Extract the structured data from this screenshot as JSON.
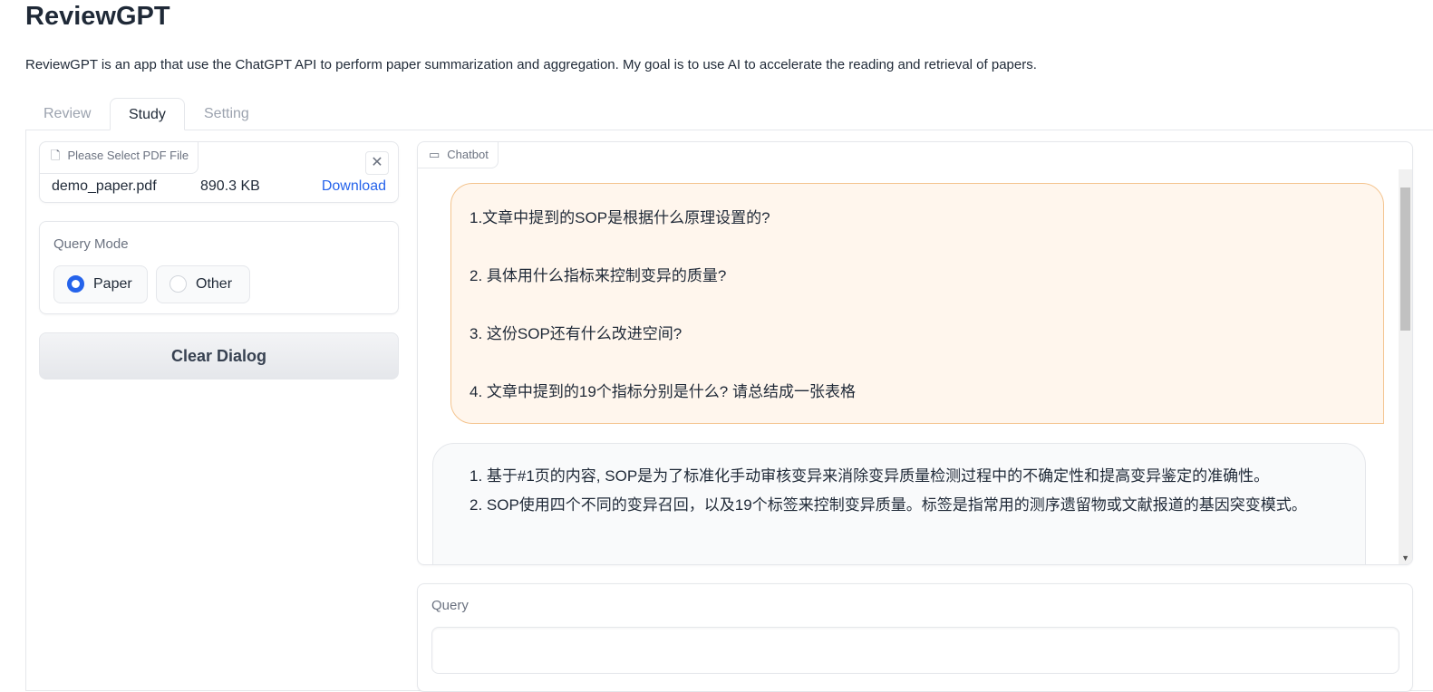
{
  "app": {
    "title": "ReviewGPT",
    "description": "ReviewGPT is an app that use the ChatGPT API to perform paper summarization and aggregation. My goal is to use AI to accelerate the reading and retrieval of papers."
  },
  "tabs": [
    {
      "label": "Review"
    },
    {
      "label": "Study",
      "active": true
    },
    {
      "label": "Setting"
    }
  ],
  "file": {
    "label": "Please Select PDF File",
    "name": "demo_paper.pdf",
    "size": "890.3 KB",
    "download": "Download"
  },
  "query_mode": {
    "label": "Query Mode",
    "options": [
      "Paper",
      "Other"
    ],
    "selected": "Paper"
  },
  "clear_button": "Clear Dialog",
  "chatbot": {
    "label": "Chatbot",
    "user_lines": [
      "1.文章中提到的SOP是根据什么原理设置的?",
      "2. 具体用什么指标来控制变异的质量?",
      "3. 这份SOP还有什么改进空间?",
      "4. 文章中提到的19个指标分别是什么? 请总结成一张表格"
    ],
    "bot_lines": [
      "1. 基于#1页的内容, SOP是为了标准化手动审核变异来消除变异质量检测过程中的不确定性和提高变异鉴定的准确性。",
      "2. SOP使用四个不同的变异召回，以及19个标签来控制变异质量。标签是指常用的测序遗留物或文献报道的基因突变模式。"
    ]
  },
  "query": {
    "label": "Query",
    "value": ""
  },
  "colors": {
    "accent": "#2563eb",
    "user_bubble": "#fff6ed",
    "user_border": "#f4c48f",
    "link": "#2563eb"
  }
}
